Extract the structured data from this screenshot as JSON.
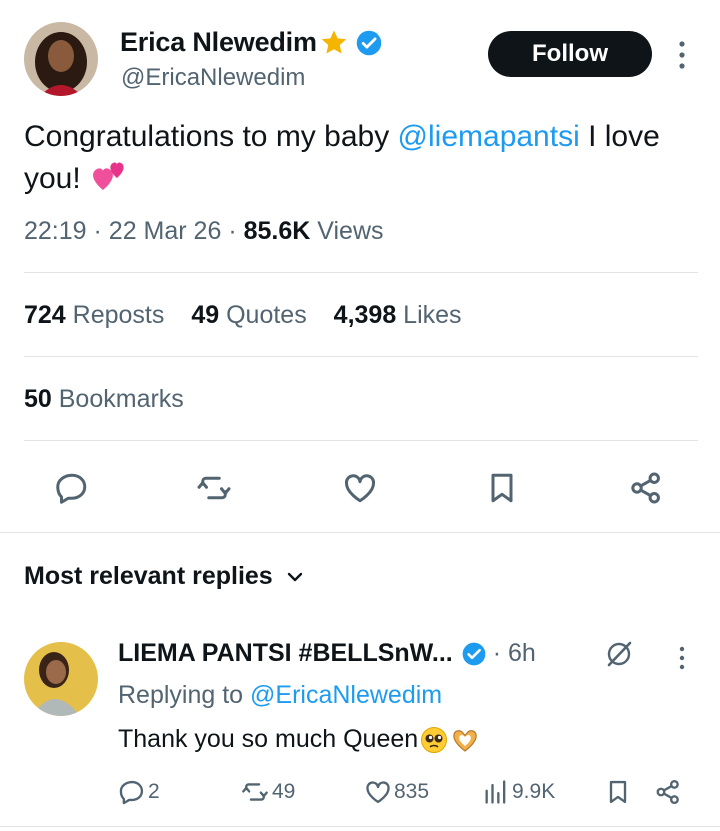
{
  "tweet": {
    "author_name": "Erica Nlewedim",
    "author_handle": "@EricaNlewedim",
    "follow_label": "Follow",
    "text_before": "Congratulations to my baby ",
    "mention": "@liemapantsi",
    "text_after": " I love you! ",
    "emoji": "two-hearts-emoji",
    "time": "22:19",
    "date": "22 Mar 26",
    "views_count": "85.6K",
    "views_label": " Views"
  },
  "stats": {
    "reposts_count": "724",
    "reposts_label": " Reposts",
    "quotes_count": "49",
    "quotes_label": " Quotes",
    "likes_count": "4,398",
    "likes_label": " Likes",
    "bookmarks_count": "50",
    "bookmarks_label": " Bookmarks"
  },
  "actions": [
    "reply-icon",
    "repost-icon",
    "like-icon",
    "bookmark-icon",
    "share-icon"
  ],
  "replies": {
    "header": "Most relevant replies",
    "items": [
      {
        "name": "LIEMA PANTSI #BELLSnW...",
        "time": "· 6h",
        "replying_prefix": "Replying to ",
        "replying_to": "@EricaNlewedim",
        "text": "Thank you so much Queen",
        "reply_count": "2",
        "repost_count": "49",
        "like_count": "835",
        "view_count": "9.9K"
      }
    ]
  },
  "colors": {
    "accent": "#1d9bf0",
    "text": "#0f1419",
    "secondary": "#536471",
    "verified": "#1d9bf0",
    "star": "#f4b400"
  }
}
